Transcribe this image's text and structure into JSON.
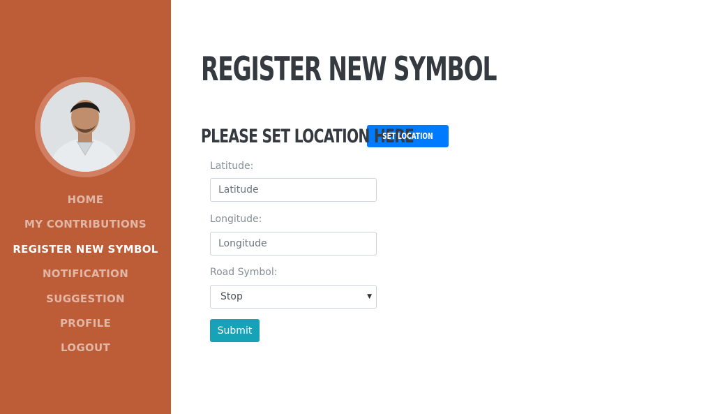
{
  "sidebar": {
    "background": "#bd5d38",
    "nav": [
      {
        "label": "HOME",
        "active": false
      },
      {
        "label": "MY CONTRIBUTIONS",
        "active": false
      },
      {
        "label": "REGISTER NEW SYMBOL",
        "active": true
      },
      {
        "label": "NOTIFICATION",
        "active": false
      },
      {
        "label": "SUGGESTION",
        "active": false
      },
      {
        "label": "PROFILE",
        "active": false
      },
      {
        "label": "LOGOUT",
        "active": false
      }
    ]
  },
  "main": {
    "title": "REGISTER NEW SYMBOL",
    "location_heading": "PLEASE SET LOCATION HERE",
    "set_location_label": "SET LOCATION",
    "form": {
      "latitude": {
        "label": "Latitude:",
        "placeholder": "Latitude",
        "value": ""
      },
      "longitude": {
        "label": "Longitude:",
        "placeholder": "Longitude",
        "value": ""
      },
      "road_symbol": {
        "label": "Road Symbol:",
        "selected": "Stop"
      },
      "submit_label": "Submit"
    }
  },
  "colors": {
    "accent": "#bd5d38",
    "primary_button": "#007bff",
    "submit_button": "#17a2b8",
    "heading": "#343a40"
  }
}
